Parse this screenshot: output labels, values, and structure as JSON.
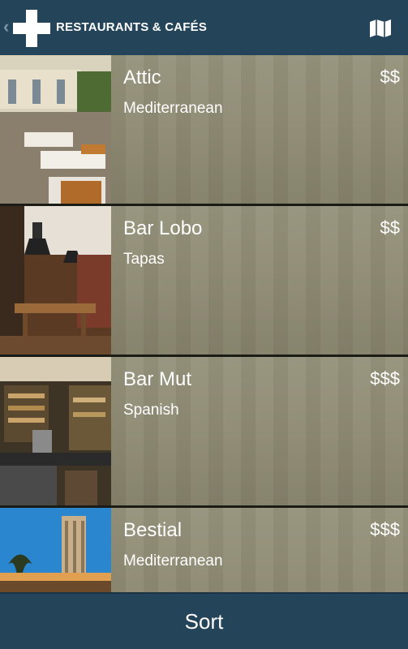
{
  "header": {
    "title": "RESTAURANTS & CAFÉS",
    "back_icon": "chevron-left-icon",
    "logo_icon": "plus-cross-icon",
    "map_icon": "map-icon"
  },
  "restaurants": [
    {
      "name": "Attic",
      "cuisine": "Mediterranean",
      "price": "$$"
    },
    {
      "name": "Bar Lobo",
      "cuisine": "Tapas",
      "price": "$$"
    },
    {
      "name": "Bar Mut",
      "cuisine": "Spanish",
      "price": "$$$"
    },
    {
      "name": "Bestial",
      "cuisine": "Mediterranean",
      "price": "$$$"
    }
  ],
  "footer": {
    "sort_label": "Sort"
  },
  "colors": {
    "header_bg": "#244559",
    "row_overlay": "#8d8a76",
    "text": "#ffffff"
  }
}
